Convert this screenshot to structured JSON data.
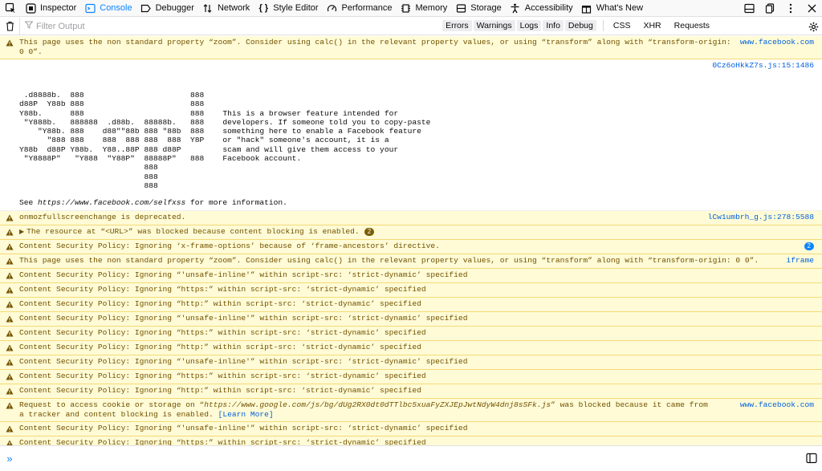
{
  "toolbar": {
    "tabs": [
      {
        "label": "Inspector",
        "icon": "inspector-icon"
      },
      {
        "label": "Console",
        "icon": "console-icon",
        "selected": true
      },
      {
        "label": "Debugger",
        "icon": "debugger-icon"
      },
      {
        "label": "Network",
        "icon": "network-icon"
      },
      {
        "label": "Style Editor",
        "icon": "style-editor-icon"
      },
      {
        "label": "Performance",
        "icon": "performance-icon"
      },
      {
        "label": "Memory",
        "icon": "memory-icon"
      },
      {
        "label": "Storage",
        "icon": "storage-icon"
      },
      {
        "label": "Accessibility",
        "icon": "accessibility-icon"
      },
      {
        "label": "What's New",
        "icon": "whats-new-icon"
      }
    ],
    "accent_color": "#0a84ff"
  },
  "filterbar": {
    "placeholder": "Filter Output",
    "levels": [
      "Errors",
      "Warnings",
      "Logs",
      "Info",
      "Debug"
    ],
    "css": "CSS",
    "xhr": "XHR",
    "requests": "Requests"
  },
  "messages": {
    "m1": {
      "text": "This page uses the non standard property “zoom”. Consider using calc() in the relevant property values, or using “transform” along with “transform-origin: 0 0”.",
      "source": "www.facebook.com"
    },
    "m1b": {
      "source": "0Cz6oHkkZ7s.js:15:1486"
    },
    "selfxss": {
      "ascii": " .d8888b.  888                       888\nd88P  Y88b 888                       888\nY88b.      888                       888    This is a browser feature intended for\n \"Y888b.   888888  .d88b.  88888b.   888    developers. If someone told you to copy-paste\n    \"Y88b. 888    d88\"\"88b 888 \"88b  888    something here to enable a Facebook feature\n      \"888 888    888  888 888  888  Y8P    or \"hack\" someone's account, it is a\nY88b  d88P Y88b.  Y88..88P 888 d88P         scam and will give them access to your\n \"Y8888P\"   \"Y888  \"Y88P\"  88888P\"   888    Facebook account.\n                           888\n                           888\n                           888",
      "see_prefix": "See ",
      "see_url": "https://www.facebook.com/selfxss",
      "see_suffix": " for more information."
    },
    "m2": {
      "text": "onmozfullscreenchange is deprecated.",
      "source": "lCw1umbrh_g.js:278:5588"
    },
    "m3": {
      "text": "The resource at “<URL>” was blocked because content blocking is enabled.",
      "badge": "2"
    },
    "m4": {
      "text": "Content Security Policy: Ignoring ‘x-frame-options’ because of ‘frame-ancestors’ directive.",
      "badge": "2"
    },
    "m5": {
      "text": "This page uses the non standard property “zoom”. Consider using calc() in the relevant property values, or using “transform” along with “transform-origin: 0 0”.",
      "source": "iframe"
    },
    "csp_inline": "Content Security Policy: Ignoring “'unsafe-inline'” within script-src: ‘strict-dynamic’ specified",
    "csp_https": "Content Security Policy: Ignoring “https:” within script-src: ‘strict-dynamic’ specified",
    "csp_http": "Content Security Policy: Ignoring “http:” within script-src: ‘strict-dynamic’ specified",
    "cookie": {
      "prefix": "Request to access cookie or storage on “",
      "url": "https://www.google.com/js/bg/dUg2RX0dt0dTTlbc5xuaFyZXJEpJwtNdyW4dnj8sSFk.js",
      "suffix": "” was blocked because it came from a tracker and content blocking is enabled. ",
      "learn_more": "[Learn More]",
      "source": "www.facebook.com"
    }
  },
  "input": {
    "prompt": "»"
  }
}
